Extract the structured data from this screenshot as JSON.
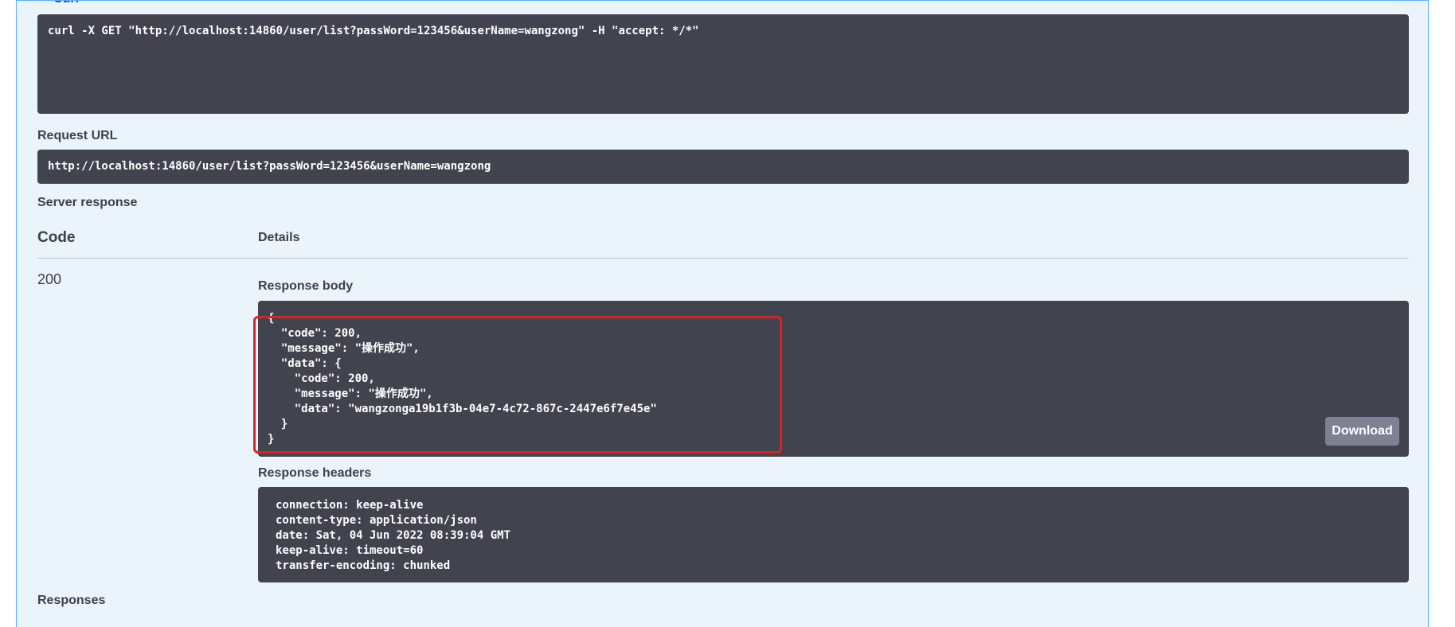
{
  "curl": {
    "label": "Curl",
    "command": "curl -X GET \"http://localhost:14860/user/list?passWord=123456&userName=wangzong\" -H \"accept: */*\""
  },
  "request_url": {
    "label": "Request URL",
    "value": "http://localhost:14860/user/list?passWord=123456&userName=wangzong"
  },
  "server_response": {
    "label": "Server response",
    "col_code": "Code",
    "col_details": "Details",
    "status_code": "200",
    "response_body_label": "Response body",
    "response_body": "{\n  \"code\": 200,\n  \"message\": \"操作成功\",\n  \"data\": {\n    \"code\": 200,\n    \"message\": \"操作成功\",\n    \"data\": \"wangzonga19b1f3b-04e7-4c72-867c-2447e6f7e45e\"\n  }\n}",
    "download_label": "Download",
    "response_headers_label": "Response headers",
    "response_headers": "connection: keep-alive\ncontent-type: application/json\ndate: Sat, 04 Jun 2022 08:39:04 GMT\nkeep-alive: timeout=60\ntransfer-encoding: chunked"
  },
  "responses": {
    "label": "Responses"
  },
  "colors": {
    "panel_bg": "#ebf3fb",
    "panel_border": "#61affe",
    "code_bg": "#41444e",
    "highlight": "#e02020",
    "download_bg": "#7d8293"
  }
}
